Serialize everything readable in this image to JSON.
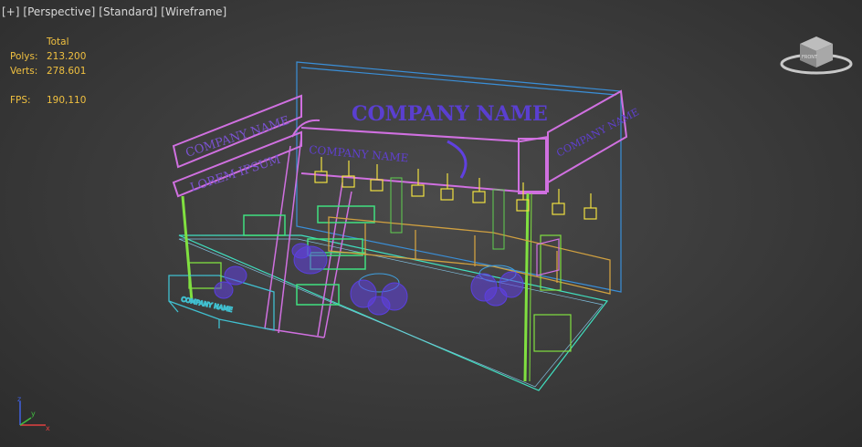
{
  "viewport": {
    "labels": [
      "[+]",
      "[Perspective]",
      "[Standard]",
      "[Wireframe]"
    ]
  },
  "stats": {
    "header": "Total",
    "polys_label": "Polys:",
    "polys_value": "213.200",
    "verts_label": "Verts:",
    "verts_value": "278.601",
    "fps_label": "FPS:",
    "fps_value": "190,110"
  },
  "scene": {
    "main_sign": "COMPANY NAME",
    "header_sign": "COMPANY NAME",
    "side_sign_top": "COMPANY NAME",
    "side_sign_bottom": "LOREM IPSUM",
    "right_sign": "COMPANY NAME",
    "counter_sign": "COMPANY NAME"
  },
  "viewcube": {
    "face_label": "FRONT"
  },
  "axis": {
    "z": "z",
    "x": "x",
    "y": "y"
  },
  "colors": {
    "pink": "#d070e0",
    "blue_wire": "#3a8fd8",
    "green": "#80e040",
    "cyan": "#40e0c0",
    "orange": "#d0a040",
    "purple_furniture": "#6040e0",
    "yellow_lamp": "#f0e040",
    "stat_text": "#f0c040"
  }
}
